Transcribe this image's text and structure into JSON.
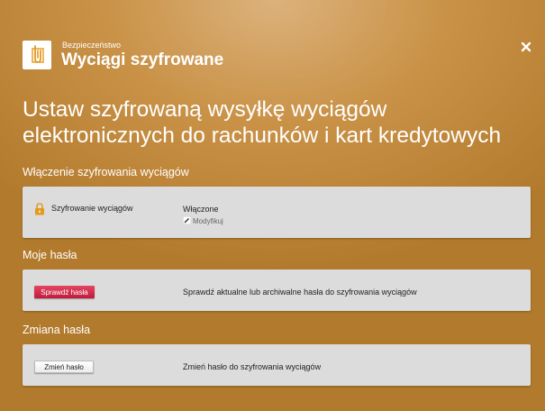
{
  "header": {
    "category": "Bezpieczeństwo",
    "title": "Wyciągi szyfrowane",
    "app_icon": "paperclip-document-icon",
    "close_icon": "close-icon"
  },
  "headline": {
    "line1": "Ustaw szyfrowaną wysyłkę wyciągów",
    "line2": "elektronicznych do rachunków i kart kredytowych"
  },
  "sections": {
    "encryption": {
      "title": "Włączenie szyfrowania wyciągów",
      "label": "Szyfrowanie wyciągów",
      "status": "Włączone",
      "modify_label": "Modyfikuj",
      "icon": "lock-icon"
    },
    "passwords": {
      "title": "Moje hasła",
      "button_label": "Sprawdź hasła",
      "description": "Sprawdź aktualne lub archiwalne hasła do szyfrowania wyciągów"
    },
    "change": {
      "title": "Zmiana hasła",
      "button_label": "Zmień hasło",
      "description": "Zmień hasło do szyfrowania wyciągów"
    }
  },
  "colors": {
    "background": "#c18a3c",
    "accent_red": "#c8203f",
    "panel": "#dcdcdc",
    "lock": "#e39a1e"
  }
}
